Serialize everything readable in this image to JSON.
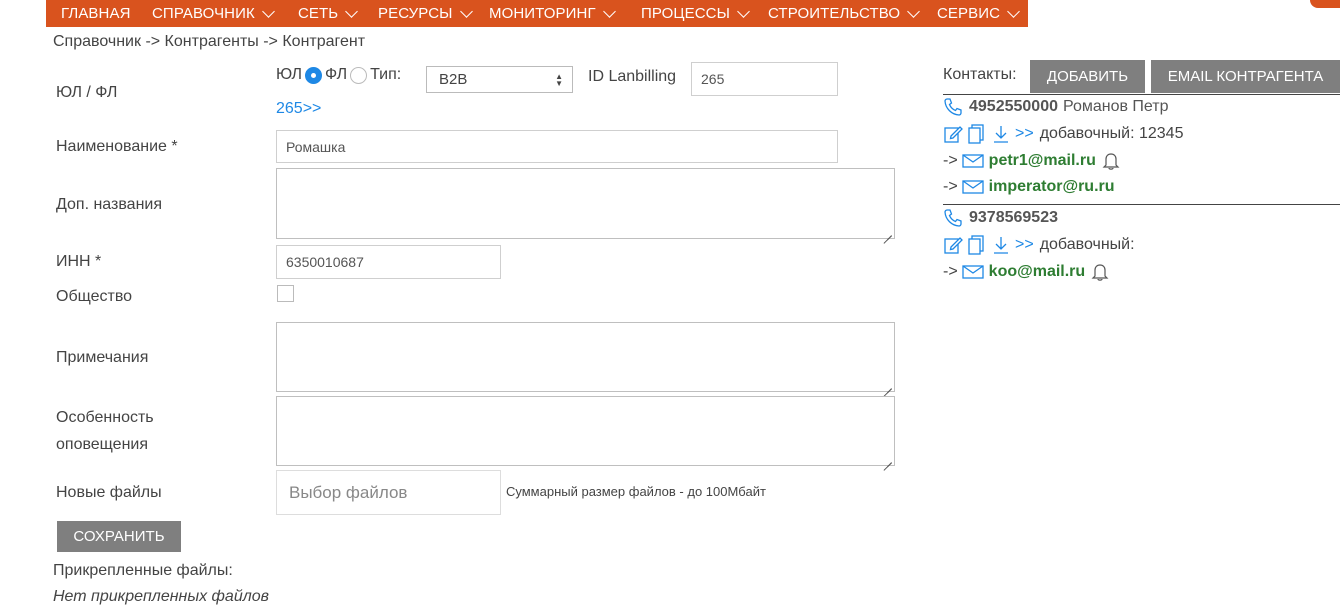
{
  "nav": {
    "items": [
      "ГЛАВНАЯ",
      "СПРАВОЧНИК",
      "СЕТЬ",
      "РЕСУРСЫ",
      "МОНИТОРИНГ",
      "ПРОЦЕССЫ",
      "СТРОИТЕЛЬСТВО",
      "СЕРВИС"
    ]
  },
  "breadcrumb": "Справочник -> Контрагенты -> Контрагент",
  "form": {
    "entity_type_label": "ЮЛ / ФЛ",
    "radio_ul": "ЮЛ",
    "radio_fl": "ФЛ",
    "type_label": "Тип:",
    "type_value": "B2B",
    "lanbilling_label": "ID Lanbilling",
    "lanbilling_value": "265",
    "lanbilling_link": "265>>",
    "name_label": "Наименование *",
    "name_value": "Ромашка",
    "alt_names_label": "Доп. названия",
    "inn_label": "ИНН *",
    "inn_value": "6350010687",
    "society_label": "Общество",
    "notes_label": "Примечания",
    "notify_label_1": "Особенность",
    "notify_label_2": "оповещения",
    "files_label": "Новые файлы",
    "file_picker": "Выбор файлов",
    "file_hint": "Суммарный размер файлов - до 100Мбайт",
    "save_button": "СОХРАНИТЬ",
    "attached_title": "Прикрепленные файлы:",
    "attached_none": "Нет прикрепленных файлов"
  },
  "contacts": {
    "label": "Контакты:",
    "add_button": "ДОБАВИТЬ",
    "email_button": "EMAIL КОНТРАГЕНТА",
    "arrows": ">>",
    "email_prefix": "->",
    "list": [
      {
        "phone": "4952550000",
        "name": "Романов Петр",
        "extension": "добавочный: 12345",
        "emails": [
          "petr1@mail.ru",
          "imperator@ru.ru"
        ]
      },
      {
        "phone": "9378569523",
        "name": "",
        "extension": "добавочный:",
        "emails": [
          "koo@mail.ru"
        ]
      }
    ]
  },
  "colors": {
    "nav_bg": "#d9531e",
    "link_blue": "#1e88e5",
    "email_green": "#2e7d32",
    "button_gray": "#7f7f7f"
  }
}
